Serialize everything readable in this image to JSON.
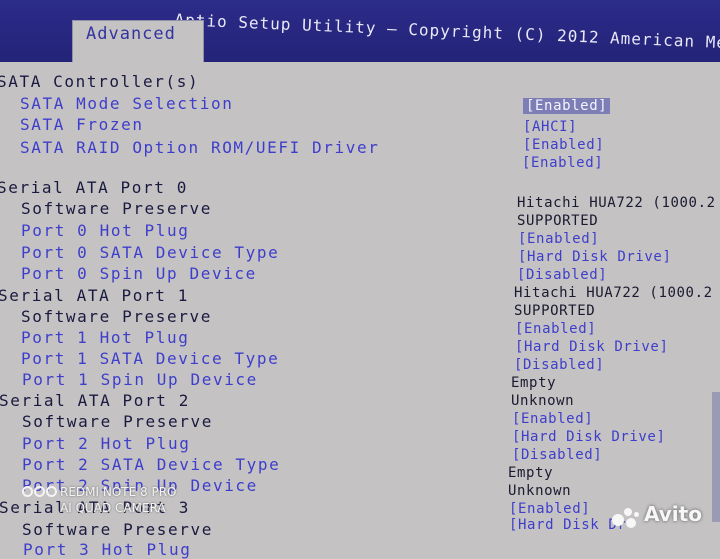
{
  "header": {
    "title": "Aptio Setup Utility – Copyright (C) 2012 American Me",
    "active_tab": "Advanced"
  },
  "menu": [
    {
      "label": "SATA Controller(s)",
      "kind": "head",
      "value": "[Enabled]",
      "value_kind": "sel"
    },
    {
      "label": "SATA Mode Selection",
      "kind": "link",
      "value": "[AHCI]",
      "value_kind": "opt"
    },
    {
      "label": "SATA Frozen",
      "kind": "link",
      "value": "[Enabled]",
      "value_kind": "opt"
    },
    {
      "label": "SATA RAID Option ROM/UEFI Driver",
      "kind": "link",
      "value": "[Enabled]",
      "value_kind": "opt"
    },
    {
      "label": "Serial ATA Port 0",
      "kind": "head",
      "value": "Hitachi HUA722 (1000.2",
      "value_kind": "info"
    },
    {
      "label": "Software Preserve",
      "kind": "sub",
      "value": "SUPPORTED",
      "value_kind": "info"
    },
    {
      "label": "Port 0 Hot Plug",
      "kind": "link",
      "value": "[Enabled]",
      "value_kind": "opt"
    },
    {
      "label": "Port 0 SATA Device Type",
      "kind": "link",
      "value": "[Hard Disk Drive]",
      "value_kind": "opt"
    },
    {
      "label": "Port 0 Spin Up Device",
      "kind": "link",
      "value": "[Disabled]",
      "value_kind": "opt"
    },
    {
      "label": "Serial ATA Port 1",
      "kind": "head",
      "value": "Hitachi HUA722 (1000.2",
      "value_kind": "info"
    },
    {
      "label": "Software Preserve",
      "kind": "sub",
      "value": "SUPPORTED",
      "value_kind": "info"
    },
    {
      "label": "Port 1 Hot Plug",
      "kind": "link",
      "value": "[Enabled]",
      "value_kind": "opt"
    },
    {
      "label": "Port 1 SATA Device Type",
      "kind": "link",
      "value": "[Hard Disk Drive]",
      "value_kind": "opt"
    },
    {
      "label": "Port 1 Spin Up Device",
      "kind": "link",
      "value": "[Disabled]",
      "value_kind": "opt"
    },
    {
      "label": "Serial ATA Port 2",
      "kind": "head",
      "value": "Empty",
      "value_kind": "info"
    },
    {
      "label": "Software Preserve",
      "kind": "sub",
      "value": "Unknown",
      "value_kind": "info"
    },
    {
      "label": "Port 2 Hot Plug",
      "kind": "link",
      "value": "[Enabled]",
      "value_kind": "opt"
    },
    {
      "label": "Port 2 SATA Device Type",
      "kind": "link",
      "value": "[Hard Disk Drive]",
      "value_kind": "opt"
    },
    {
      "label": "Port 2 Spin Up Device",
      "kind": "link",
      "value": "[Disabled]",
      "value_kind": "opt"
    },
    {
      "label": "Serial ATA Port 3",
      "kind": "head",
      "value": "Empty",
      "value_kind": "info"
    },
    {
      "label": "Software Preserve",
      "kind": "sub",
      "value": "Unknown",
      "value_kind": "info"
    },
    {
      "label": "Port 3 Hot Plug",
      "kind": "link",
      "value": "[Enabled]",
      "value_kind": "opt"
    },
    {
      "label": "",
      "kind": "link",
      "value": "[Hard Disk Dr",
      "value_kind": "opt"
    }
  ],
  "watermark": {
    "line1": "REDMI NOTE 8 PRO",
    "line2": "AI QUAD CAMERA"
  },
  "avito": {
    "text": "Avito"
  }
}
